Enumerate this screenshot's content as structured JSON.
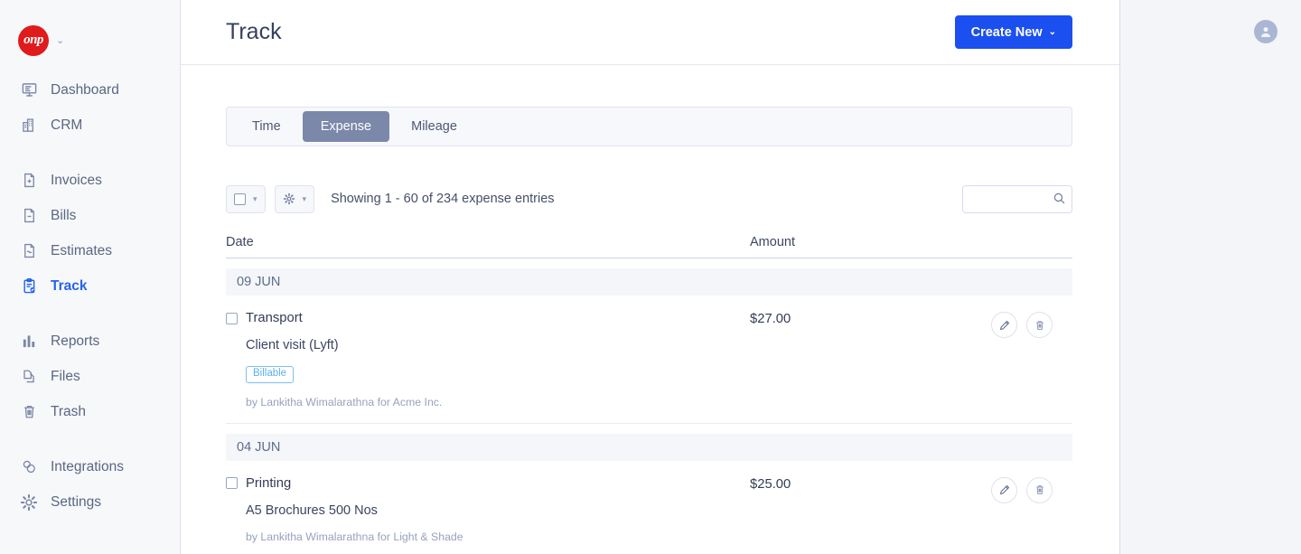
{
  "brand": {
    "logo_text": "onp",
    "caret": "⌄"
  },
  "sidebar": {
    "groups": [
      {
        "items": [
          {
            "label": "Dashboard",
            "icon": "dashboard-icon",
            "active": false
          },
          {
            "label": "CRM",
            "icon": "building-icon",
            "active": false
          }
        ]
      },
      {
        "items": [
          {
            "label": "Invoices",
            "icon": "document-plus-icon",
            "active": false
          },
          {
            "label": "Bills",
            "icon": "document-minus-icon",
            "active": false
          },
          {
            "label": "Estimates",
            "icon": "document-wave-icon",
            "active": false
          },
          {
            "label": "Track",
            "icon": "clipboard-check-icon",
            "active": true
          }
        ]
      },
      {
        "items": [
          {
            "label": "Reports",
            "icon": "bar-chart-icon",
            "active": false
          },
          {
            "label": "Files",
            "icon": "files-icon",
            "active": false
          },
          {
            "label": "Trash",
            "icon": "trash-icon",
            "active": false
          }
        ]
      },
      {
        "items": [
          {
            "label": "Integrations",
            "icon": "integrations-icon",
            "active": false
          },
          {
            "label": "Settings",
            "icon": "gear-icon",
            "active": false
          }
        ]
      }
    ]
  },
  "header": {
    "title": "Track",
    "create_button": "Create New",
    "create_caret": "⌄",
    "accent_color": "#1b4ff0"
  },
  "tabs": [
    {
      "label": "Time",
      "active": false
    },
    {
      "label": "Expense",
      "active": true
    },
    {
      "label": "Mileage",
      "active": false
    }
  ],
  "toolbar": {
    "select_all_label": "",
    "gear_label": "",
    "caret": "▾",
    "showing_text": "Showing 1 - 60 of 234 expense entries",
    "search_value": "",
    "search_placeholder": ""
  },
  "table": {
    "columns": {
      "date": "Date",
      "amount": "Amount"
    },
    "groups": [
      {
        "date_label": "09 JUN",
        "entries": [
          {
            "title": "Transport",
            "amount": "$27.00",
            "description": "Client visit (Lyft)",
            "badge": "Billable",
            "byline": "by Lankitha Wimalarathna for Acme Inc."
          }
        ]
      },
      {
        "date_label": "04 JUN",
        "entries": [
          {
            "title": "Printing",
            "amount": "$25.00",
            "description": "A5 Brochures 500 Nos",
            "badge": "",
            "byline": "by Lankitha Wimalarathna for Light & Shade"
          }
        ]
      }
    ]
  },
  "account": {
    "avatar_icon": "user-avatar-icon"
  }
}
